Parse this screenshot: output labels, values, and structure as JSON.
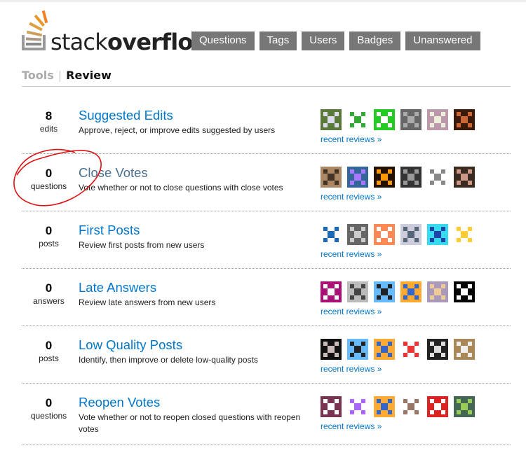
{
  "logo": {
    "light": "stack",
    "bold": "overflow"
  },
  "nav": [
    "Questions",
    "Tags",
    "Users",
    "Badges",
    "Unanswered"
  ],
  "subnav": {
    "tools": "Tools",
    "separator": "|",
    "review": "Review"
  },
  "queues": [
    {
      "count": "8",
      "unit": "edits",
      "title": "Suggested Edits",
      "description": "Approve, reject, or improve edits suggested by users",
      "recent": "recent reviews »",
      "avatars": [
        [
          "#5a7a3a",
          "#dde"
        ],
        [
          "#fff",
          "#3a3"
        ],
        [
          "#2c2",
          "#fff"
        ],
        [
          "#666",
          "#aaa"
        ],
        [
          "#b9a",
          "#eed"
        ],
        [
          "#3a1a0a",
          "#c63"
        ]
      ]
    },
    {
      "count": "0",
      "unit": "questions",
      "title": "Close Votes",
      "description": "Vote whether or not to close questions with close votes",
      "recent": "recent reviews »",
      "avatars": [
        [
          "#a86",
          "#432"
        ],
        [
          "#369",
          "#a7f"
        ],
        [
          "#210",
          "#f90"
        ],
        [
          "#333",
          "#999"
        ],
        [
          "#fff",
          "#888"
        ],
        [
          "#3a2a20",
          "#c98"
        ]
      ]
    },
    {
      "count": "0",
      "unit": "posts",
      "title": "First Posts",
      "description": "Review first posts from new users",
      "recent": "recent reviews »",
      "avatars": [
        [
          "#fff",
          "#1a6ab8"
        ],
        [
          "#666",
          "#ccc"
        ],
        [
          "#f85",
          "#fff"
        ],
        [
          "#ccd",
          "#567"
        ],
        [
          "#3de",
          "#24a"
        ],
        [
          "#fff",
          "#fc3"
        ]
      ]
    },
    {
      "count": "0",
      "unit": "answers",
      "title": "Late Answers",
      "description": "Review late answers from new users",
      "recent": "recent reviews »",
      "avatars": [
        [
          "#a17",
          "#fff"
        ],
        [
          "#bbb",
          "#444"
        ],
        [
          "#6bf",
          "#222"
        ],
        [
          "#fa3",
          "#36c"
        ],
        [
          "#a9b",
          "#ec9"
        ],
        [
          "#000",
          "#fff"
        ]
      ]
    },
    {
      "count": "0",
      "unit": "posts",
      "title": "Low Quality Posts",
      "description": "Identify, then improve or delete low-quality posts",
      "recent": "recent reviews »",
      "avatars": [
        [
          "#111",
          "#cbb"
        ],
        [
          "#6bf",
          "#222"
        ],
        [
          "#fa3",
          "#36c"
        ],
        [
          "#fff",
          "#e33"
        ],
        [
          "#222",
          "#ddd"
        ],
        [
          "#a85",
          "#eee"
        ]
      ]
    },
    {
      "count": "0",
      "unit": "questions",
      "title": "Reopen Votes",
      "description": "Vote whether or not to reopen closed questions with reopen votes",
      "recent": "recent reviews »",
      "avatars": [
        [
          "#7a3350",
          "#fff"
        ],
        [
          "#fff",
          "#a6f"
        ],
        [
          "#fa3",
          "#36c"
        ],
        [
          "#fff",
          "#976"
        ],
        [
          "#d22",
          "#fff"
        ],
        [
          "#465",
          "#9c5"
        ]
      ]
    }
  ],
  "colors": {
    "link": "#0077cc",
    "nav_bg": "#777777",
    "annotation": "#dd1111"
  }
}
